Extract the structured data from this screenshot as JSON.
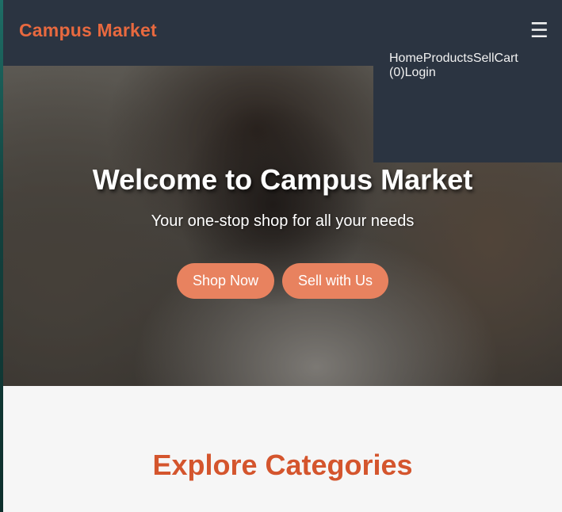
{
  "navbar": {
    "brand": "Campus Market",
    "menu_icon": "hamburger-menu-icon",
    "menu_glyph": "☰",
    "links": [
      {
        "label": "Home"
      },
      {
        "label": "Products"
      },
      {
        "label": "Sell"
      },
      {
        "label": "Cart (0)"
      },
      {
        "label": "Login"
      }
    ]
  },
  "hero": {
    "title": "Welcome to Campus Market",
    "subtitle": "Your one-stop shop for all your needs",
    "buttons": {
      "shop_now": "Shop Now",
      "sell_with_us": "Sell with Us"
    }
  },
  "categories": {
    "title": "Explore Categories"
  },
  "colors": {
    "navbar_bg": "#2b3441",
    "brand_accent": "#e8693f",
    "button_bg": "#e8825f",
    "section_heading": "#d4552d",
    "section_bg": "#f6f6f6"
  }
}
